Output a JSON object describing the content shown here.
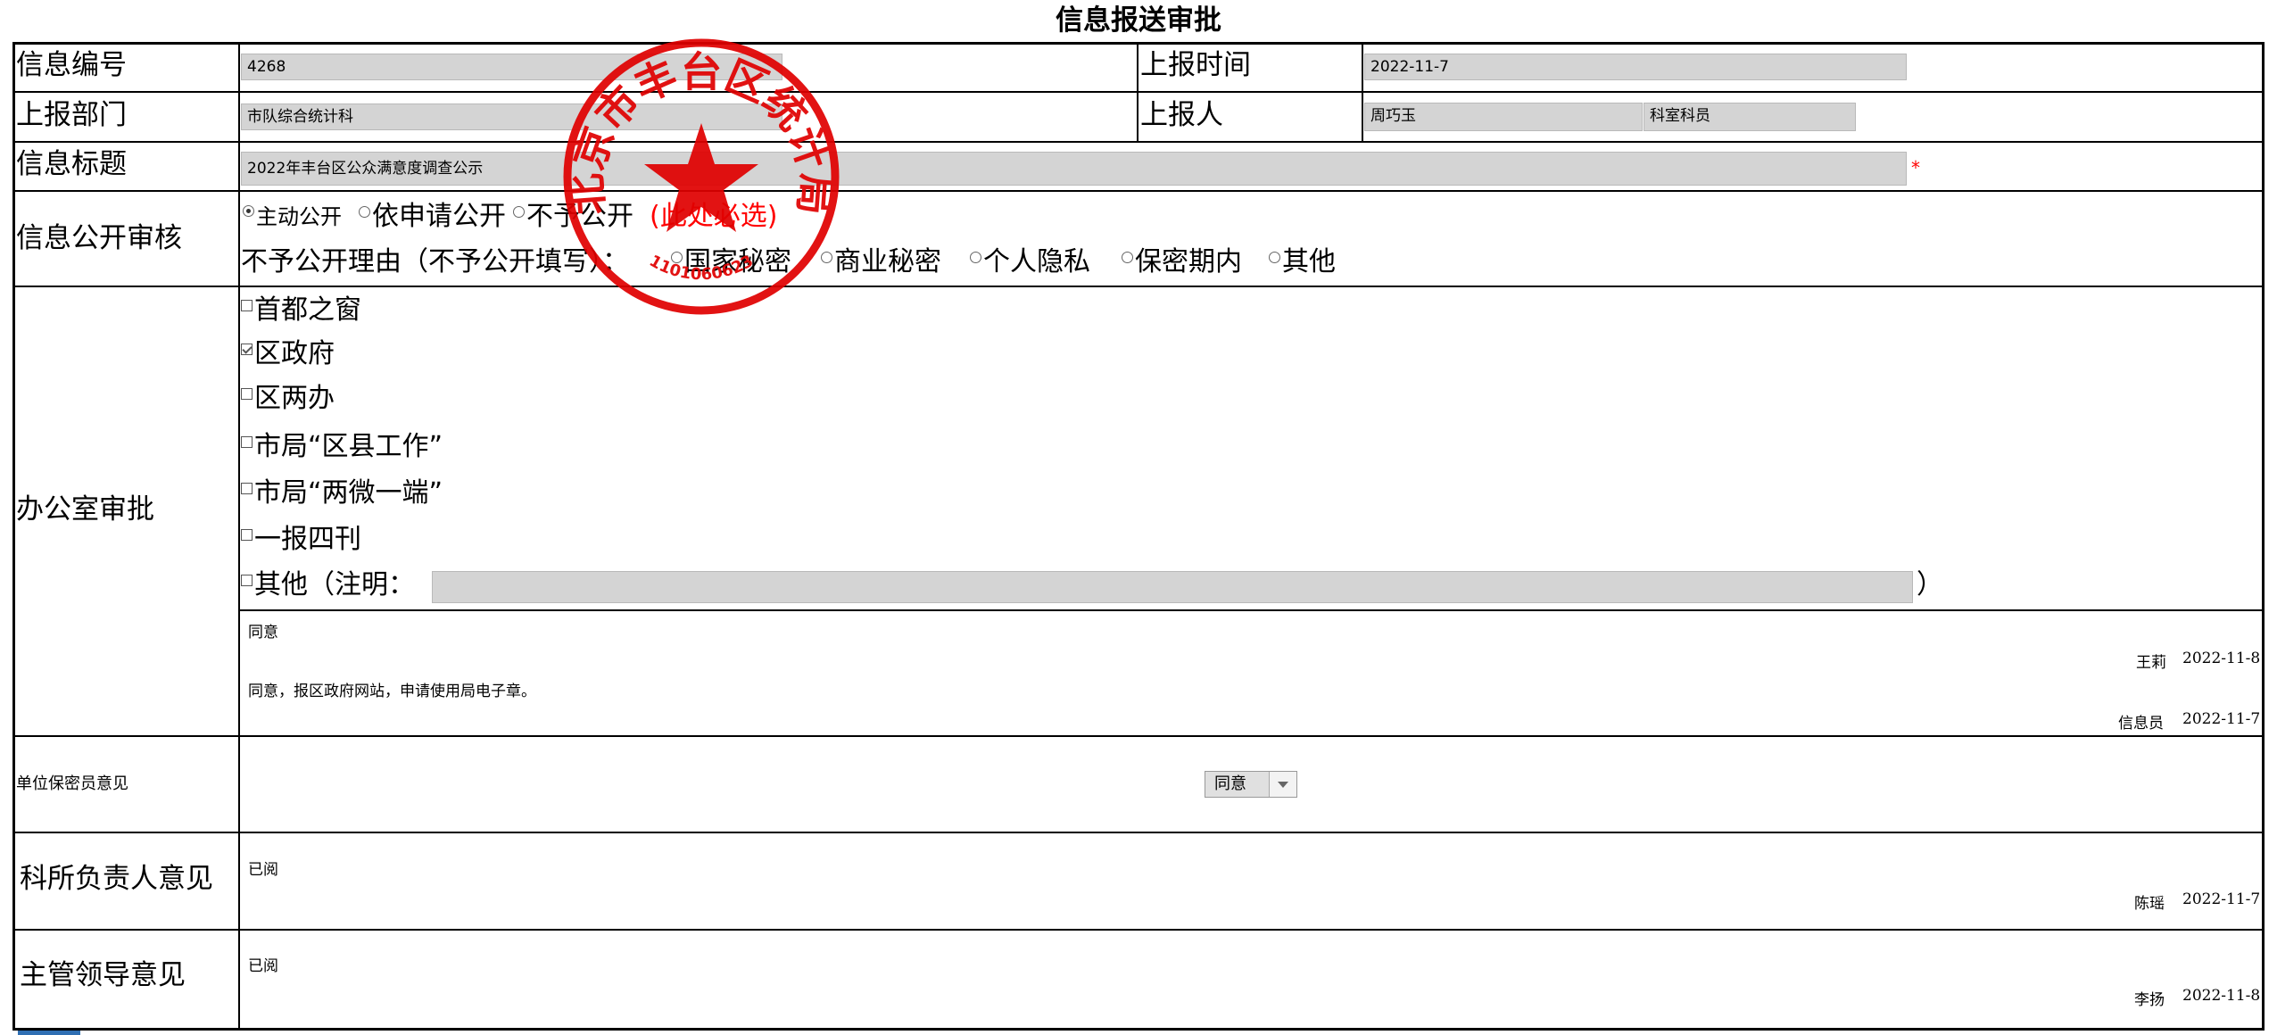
{
  "title": "信息报送审批",
  "rows": {
    "info_number": {
      "label": "信息编号",
      "value": "4268"
    },
    "report_time": {
      "label": "上报时间",
      "value": "2022-11-7"
    },
    "report_dept": {
      "label": "上报部门",
      "value": "市队综合统计科"
    },
    "reporter": {
      "label": "上报人",
      "name": "周巧玉",
      "position": "科室科员"
    },
    "info_title": {
      "label": "信息标题",
      "value": "2022年丰台区公众满意度调查公示",
      "required_mark": "*"
    },
    "disclosure": {
      "label": "信息公开审核",
      "options": [
        "主动公开",
        "依申请公开",
        "不予公开"
      ],
      "selected": "主动公开",
      "required_note": "(此处必选)",
      "reason_label": "不予公开理由（不予公开填写）：",
      "reasons": [
        "国家秘密",
        "商业秘密",
        "个人隐私",
        "保密期内",
        "其他"
      ]
    },
    "office": {
      "label": "办公室审批",
      "channels": [
        {
          "label": "首都之窗",
          "checked": false
        },
        {
          "label": "区政府",
          "checked": true
        },
        {
          "label": "区两办",
          "checked": false
        },
        {
          "label": "市局“区县工作”",
          "checked": false
        },
        {
          "label": "市局“两微一端”",
          "checked": false
        },
        {
          "label": "一报四刊",
          "checked": false
        }
      ],
      "other_label": "其他（注明：",
      "other_close": "）",
      "comments": [
        {
          "text": "同意",
          "signer": "王莉",
          "date": "2022-11-8"
        },
        {
          "text": "同意，报区政府网站，申请使用局电子章。",
          "signer": "信息员",
          "date": "2022-11-7"
        }
      ]
    },
    "security": {
      "label": "单位保密员意见",
      "select_value": "同意"
    },
    "section_head": {
      "label": "科所负责人意见",
      "text": "已阅",
      "signer": "陈瑶",
      "date": "2022-11-7"
    },
    "leader": {
      "label": "主管领导意见",
      "text": "已阅",
      "signer": "李扬",
      "date": "2022-11-8"
    }
  },
  "seal": {
    "text": "北京市丰台区统计局",
    "number": "1101060623",
    "color": "#e00000"
  },
  "colors": {
    "field_bg": "#d4d4d4",
    "required": "#ff0000",
    "border": "#000000"
  }
}
